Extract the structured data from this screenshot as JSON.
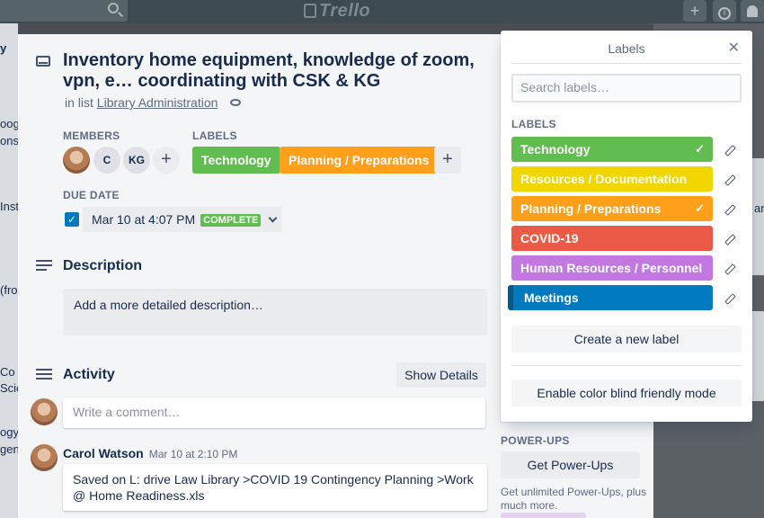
{
  "header": {
    "logo": "Trello",
    "add_icon": "plus-icon",
    "info_icon": "info-icon",
    "notifications_icon": "bell-icon"
  },
  "background": {
    "fragments_left": [
      "y",
      "oogl",
      "onse",
      "Inst",
      "(fro",
      "Co",
      "Scie",
      "ogy",
      "gen"
    ],
    "fragments_right": [
      "an"
    ]
  },
  "card": {
    "title": "Inventory home equipment, knowledge of zoom, vpn, e… coordinating with CSK & KG",
    "in_list_prefix": "in list",
    "list_name": "Library Administration",
    "members_heading": "MEMBERS",
    "members": [
      "C",
      "KG"
    ],
    "labels_heading": "LABELS",
    "labels": [
      {
        "name": "Technology",
        "color": "#61bd4f"
      },
      {
        "name": "Planning / Preparations",
        "color": "#ff9f1a"
      }
    ],
    "due_heading": "DUE DATE",
    "due_date": "Mar 10 at 4:07 PM",
    "due_status": "COMPLETE",
    "description_heading": "Description",
    "description_placeholder": "Add a more detailed description…",
    "activity_heading": "Activity",
    "show_details": "Show Details",
    "comment_placeholder": "Write a comment…",
    "comment": {
      "author": "Carol Watson",
      "time": "Mar 10 at 2:10 PM",
      "text": "Saved on L: drive Law Library >COVID 19 Contingency Planning >Work @ Home Readiness.xls"
    }
  },
  "sidebar": {
    "powerups_heading": "POWER-UPS",
    "get_powerups": "Get Power-Ups",
    "powerups_note": "Get unlimited Power-Ups, plus much more."
  },
  "labels_popover": {
    "title": "Labels",
    "search_placeholder": "Search labels…",
    "section": "LABELS",
    "items": [
      {
        "name": "Technology",
        "color": "#61bd4f",
        "checked": "✓"
      },
      {
        "name": "Resources / Documentation",
        "color": "#f2d600",
        "checked": ""
      },
      {
        "name": "Planning / Preparations",
        "color": "#ff9f1a",
        "checked": "✓"
      },
      {
        "name": "COVID-19",
        "color": "#eb5a46",
        "checked": ""
      },
      {
        "name": "Human Resources / Personnel",
        "color": "#c377e0",
        "checked": ""
      },
      {
        "name": "Meetings",
        "color": "#0079bf",
        "checked": ""
      }
    ],
    "create_label": "Create a new label",
    "color_blind_mode": "Enable color blind friendly mode"
  }
}
